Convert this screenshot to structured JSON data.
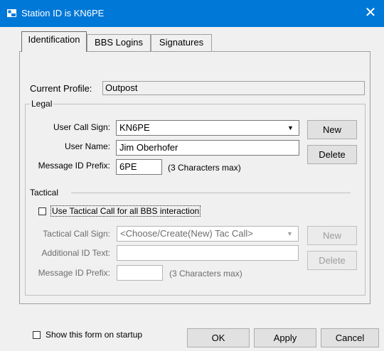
{
  "window": {
    "title": "Station ID is KN6PE",
    "close_label": "✕"
  },
  "tabs": [
    {
      "label": "Identification",
      "active": true
    },
    {
      "label": "BBS Logins",
      "active": false
    },
    {
      "label": "Signatures",
      "active": false
    }
  ],
  "current_profile": {
    "label": "Current Profile:",
    "value": "Outpost"
  },
  "legal": {
    "group_label": "Legal",
    "user_call_sign": {
      "label": "User Call Sign:",
      "value": "KN6PE"
    },
    "user_name": {
      "label": "User Name:",
      "value": "Jim Oberhofer"
    },
    "message_id_prefix": {
      "label": "Message ID Prefix:",
      "value": "6PE",
      "hint": "(3 Characters max)"
    },
    "new_label": "New",
    "delete_label": "Delete"
  },
  "tactical": {
    "section_label": "Tactical",
    "use_tactical_label": "Use Tactical Call for all BBS interaction",
    "use_tactical_checked": false,
    "tactical_call_sign": {
      "label": "Tactical Call Sign:",
      "value": "<Choose/Create(New) Tac Call>"
    },
    "additional_id_text": {
      "label": "Additional ID Text:",
      "value": ""
    },
    "message_id_prefix": {
      "label": "Message ID Prefix:",
      "value": "",
      "hint": "(3 Characters max)"
    },
    "new_label": "New",
    "delete_label": "Delete"
  },
  "footer": {
    "show_on_startup_label": "Show this form on startup",
    "show_on_startup_checked": false,
    "ok_label": "OK",
    "apply_label": "Apply",
    "cancel_label": "Cancel"
  }
}
